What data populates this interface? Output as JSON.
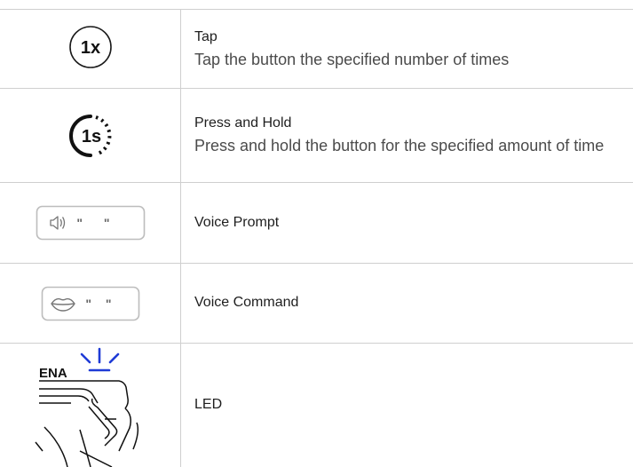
{
  "rows": [
    {
      "icon": "tap-1x-icon",
      "icon_text": "1x",
      "term": "Tap",
      "description": "Tap the button the specified number of times"
    },
    {
      "icon": "press-hold-1s-icon",
      "icon_text": "1s",
      "term": "Press and Hold",
      "description": "Press and hold the button for the specified amount of time"
    },
    {
      "icon": "voice-prompt-icon",
      "icon_text": "\" \"",
      "term": "Voice Prompt",
      "description": ""
    },
    {
      "icon": "voice-command-icon",
      "icon_text": "\" \"",
      "term": "Voice Command",
      "description": ""
    },
    {
      "icon": "led-icon",
      "icon_text": "ENA",
      "term": "LED",
      "description": ""
    }
  ],
  "colors": {
    "rule": "#cfcfcf",
    "icon_stroke": "#1a1a1a",
    "icon_box": "#bdbdbd",
    "led_blue": "#1f3bd6"
  }
}
